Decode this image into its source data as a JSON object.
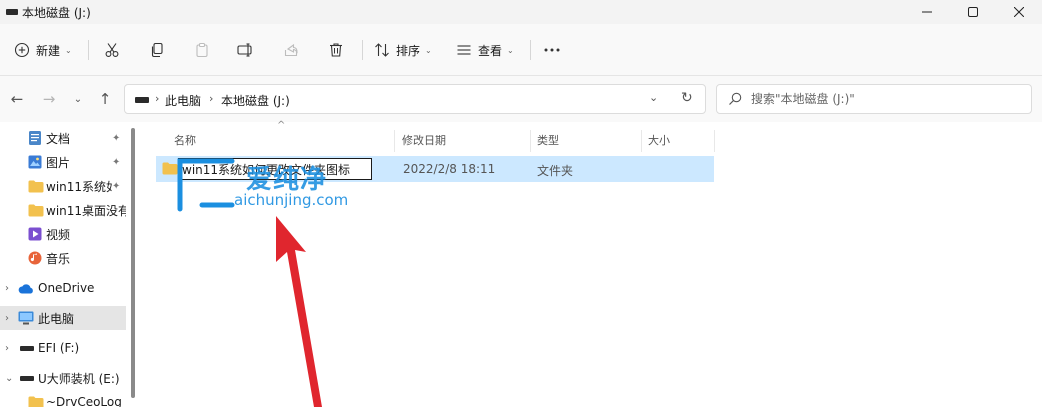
{
  "window": {
    "title": "本地磁盘 (J:)",
    "icon": "drive-icon",
    "controls": [
      "minimize-icon",
      "maximize-icon",
      "close-icon"
    ]
  },
  "toolbar": {
    "new_label": "新建",
    "sort_label": "排序",
    "view_label": "查看",
    "icons": [
      "plus-circle-icon",
      "cut-icon",
      "copy-icon",
      "paste-icon",
      "rename-icon",
      "share-icon",
      "delete-icon",
      "sort-icon",
      "view-icon",
      "more-icon"
    ]
  },
  "address": {
    "crumbs": [
      "此电脑",
      "本地磁盘 (J:)"
    ],
    "search_placeholder": "搜索\"本地磁盘 (J:)\""
  },
  "nav": {
    "items": [
      {
        "label": "文档",
        "icon": "document-icon",
        "pinned": true
      },
      {
        "label": "图片",
        "icon": "pictures-icon",
        "pinned": true
      },
      {
        "label": "win11系统如",
        "icon": "folder-icon",
        "pinned": true
      },
      {
        "label": "win11桌面没有!",
        "icon": "folder-icon",
        "pinned": false
      },
      {
        "label": "视频",
        "icon": "video-icon",
        "pinned": false
      },
      {
        "label": "音乐",
        "icon": "music-icon",
        "pinned": false
      },
      {
        "label": "OneDrive",
        "icon": "onedrive-icon",
        "pinned": false
      },
      {
        "label": "此电脑",
        "icon": "this-pc-icon",
        "pinned": false,
        "selected": true
      },
      {
        "label": "EFI (F:)",
        "icon": "drive-icon",
        "pinned": false
      },
      {
        "label": "U大师装机 (E:)",
        "icon": "drive-icon",
        "pinned": false
      },
      {
        "label": "~DrvCeoLog",
        "icon": "folder-icon",
        "pinned": false
      }
    ]
  },
  "columns": {
    "name": "名称",
    "date": "修改日期",
    "type": "类型",
    "size": "大小"
  },
  "files": [
    {
      "name": "win11系统如何更改文件夹图标",
      "date": "2022/2/8 18:11",
      "type": "文件夹"
    }
  ],
  "watermark": {
    "text": "爱纯净",
    "url": "aichunjing.com"
  },
  "colors": {
    "selection": "#cce8ff",
    "folder": "#f2c14e",
    "watermark": "#1b8fe0",
    "arrow": "#e0262e"
  }
}
